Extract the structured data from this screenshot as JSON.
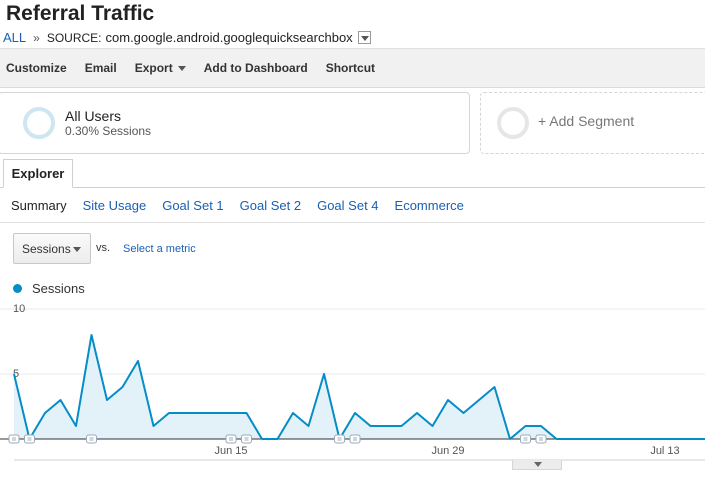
{
  "page": {
    "title": "Referral Traffic",
    "breadcrumb": {
      "all_label": "ALL",
      "separator": "»",
      "source_label": "SOURCE:",
      "source_value": "com.google.android.googlequicksearchbox"
    }
  },
  "toolbar": {
    "items": [
      "Customize",
      "Email",
      "Export",
      "Add to Dashboard",
      "Shortcut"
    ]
  },
  "segments": {
    "active": {
      "name": "All Users",
      "detail": "0.30% Sessions"
    },
    "add_label": "+ Add Segment"
  },
  "explorer": {
    "tab_label": "Explorer",
    "subtabs": [
      "Summary",
      "Site Usage",
      "Goal Set 1",
      "Goal Set 2",
      "Goal Set 4",
      "Ecommerce"
    ],
    "active_subtab": "Summary"
  },
  "metric": {
    "selected": "Sessions",
    "vs_label": "vs.",
    "select_link": "Select a metric"
  },
  "colors": {
    "series": "#058dc7",
    "area": "#e3f1f8",
    "link": "#1a5fb4"
  },
  "chart_data": {
    "type": "line",
    "legend": "top-left",
    "grid": true,
    "series": [
      {
        "name": "Sessions",
        "values": [
          5,
          0,
          2,
          3,
          1,
          8,
          3,
          4,
          6,
          1,
          2,
          2,
          2,
          2,
          2,
          2,
          0,
          0,
          2,
          1,
          5,
          0,
          2,
          1,
          1,
          1,
          2,
          1,
          3,
          2,
          3,
          4,
          0,
          1,
          1,
          0,
          0,
          0,
          0,
          0,
          0,
          0,
          0,
          0,
          0,
          0
        ]
      }
    ],
    "y_ticks": [
      "10",
      "5"
    ],
    "ylim": [
      0,
      10
    ],
    "x_ticks": [
      "Jun 15",
      "Jun 29",
      "Jul 13"
    ],
    "annotation_days": [
      0,
      1,
      5,
      14,
      15,
      21,
      22,
      33,
      34
    ]
  }
}
